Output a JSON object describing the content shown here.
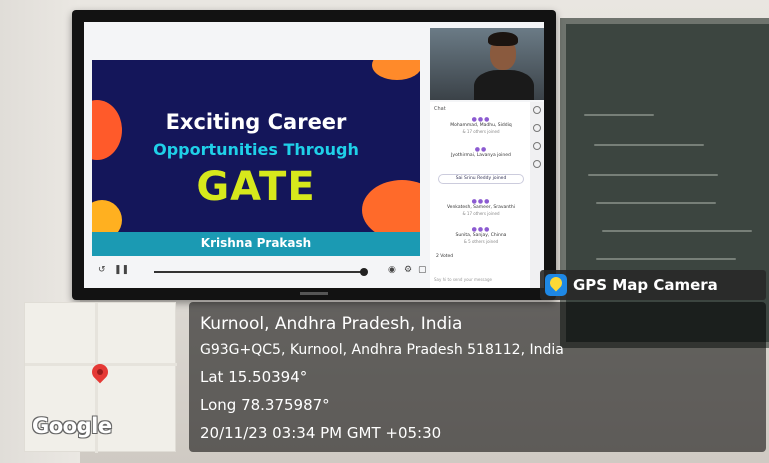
{
  "slide": {
    "line1": "Exciting Career",
    "line2": "Opportunities Through",
    "line3": "GATE",
    "presenter": "Krishna Prakash"
  },
  "chat": {
    "header": "Chat",
    "entries": [
      {
        "name": "Mohammad, Madhu, Siddiq",
        "sub": "& 17 others joined"
      },
      {
        "name": "Jyothirmai, Lavanya joined",
        "sub": ""
      },
      {
        "name": "Sai Srinu Reddy joined",
        "sub": ""
      },
      {
        "name": "Venkatesh, Sameer, Sravanthi",
        "sub": "& 17 others joined"
      },
      {
        "name": "Sunita, Sanjay, Chinna",
        "sub": "& 5 others joined"
      }
    ],
    "poll_label": "2 Voted",
    "input_placeholder": "Say hi to send your message"
  },
  "gps": {
    "badge": "GPS Map Camera",
    "city": "Kurnool, Andhra Pradesh, India",
    "address": "G93G+QC5, Kurnool, Andhra Pradesh 518112, India",
    "lat": "Lat 15.50394°",
    "long": "Long 78.375987°",
    "datetime": "20/11/23 03:34 PM GMT +05:30",
    "map_label": "Google"
  },
  "colors": {
    "slide_bg": "#14165a",
    "accent_cyan": "#1fd0e8",
    "accent_yellow": "#d7e81c",
    "pin": "#e53935"
  }
}
